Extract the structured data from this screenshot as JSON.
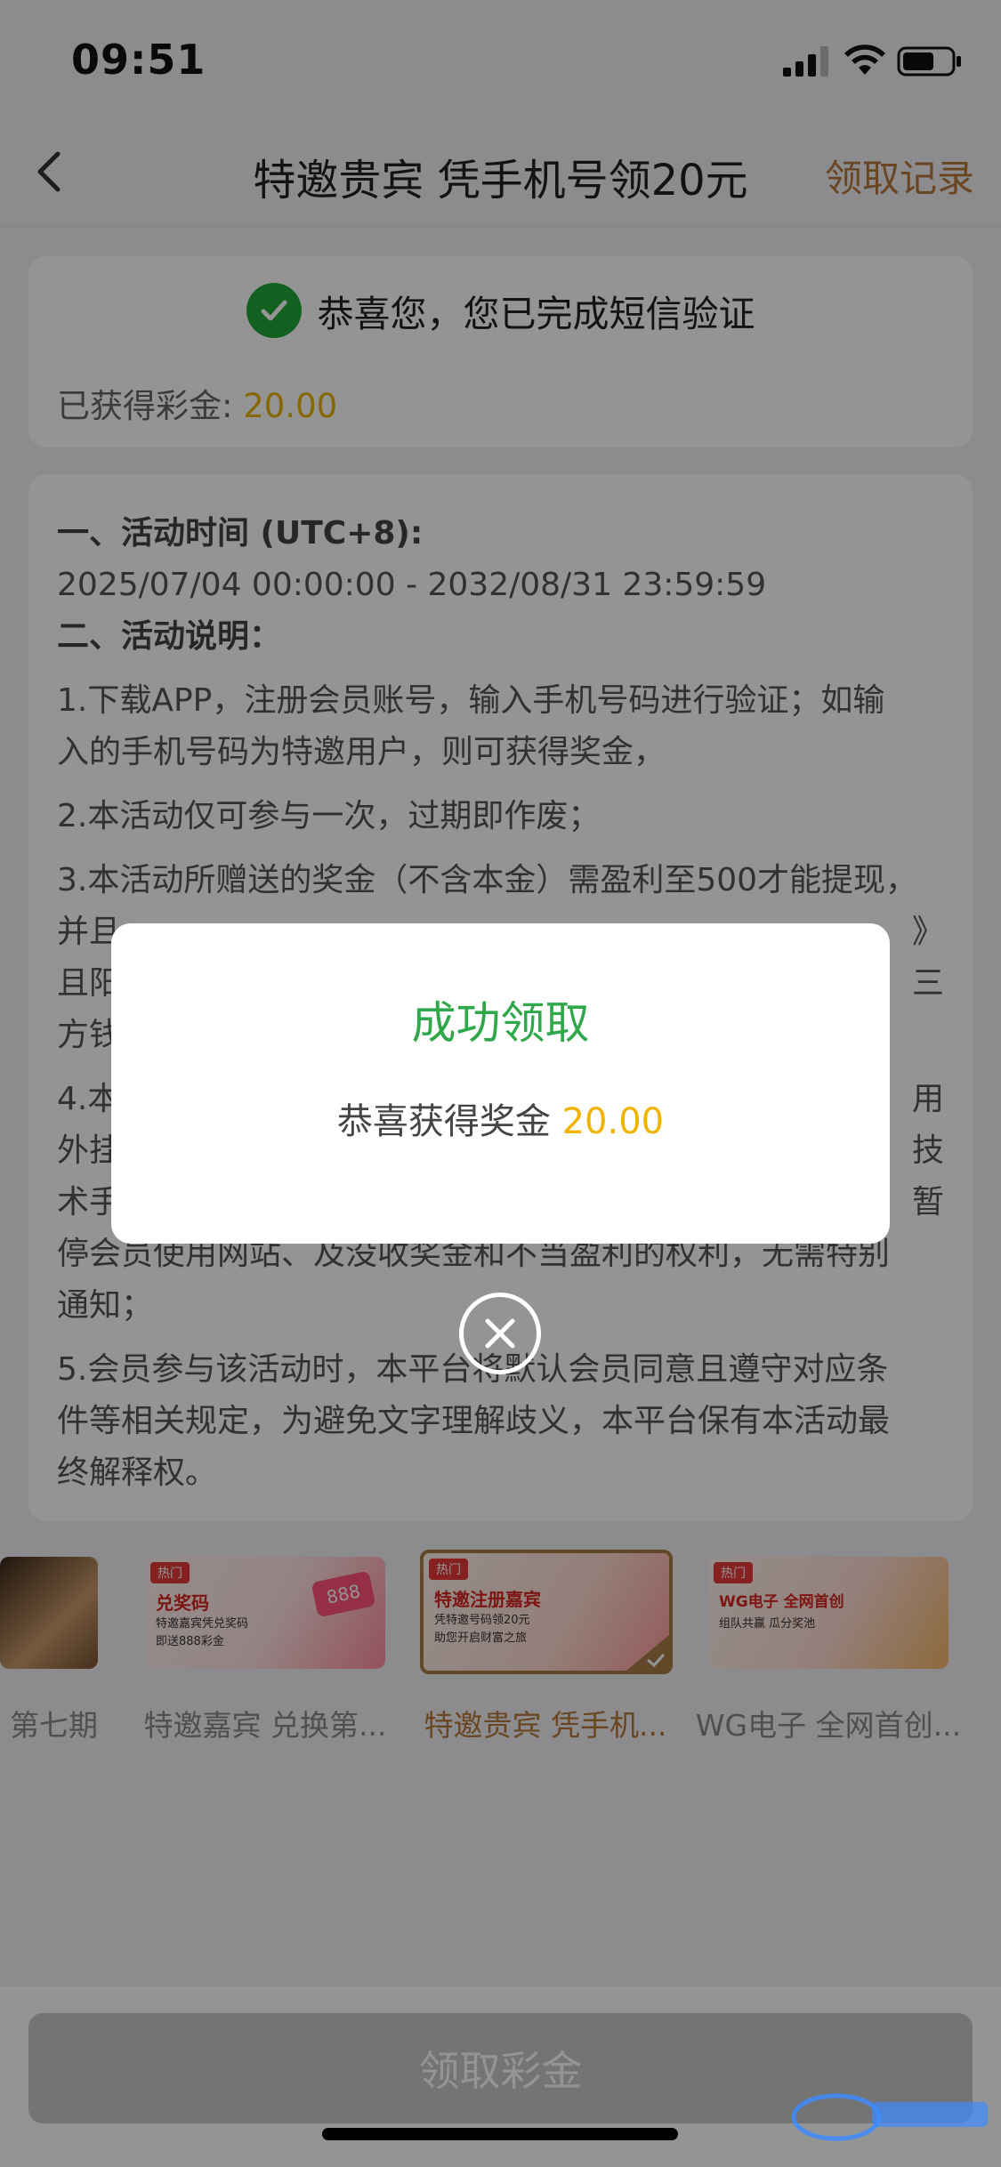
{
  "status": {
    "time": "09:51"
  },
  "nav": {
    "title": "特邀贵宾 凭手机号领20元",
    "record": "领取记录"
  },
  "verify": {
    "message": "恭喜您，您已完成短信验证",
    "earned_label": "已获得彩金: ",
    "earned_value": "20.00"
  },
  "rules": {
    "time_heading": "一、活动时间 (UTC+8):",
    "time_range": "2025/07/04 00:00:00 - 2032/08/31 23:59:59",
    "desc_heading": "二、活动说明：",
    "r1a": "1.下载APP，注册会员账号，输入手机号码进行验证；如输",
    "r1b": "入的手机号码为特邀用户，则可获得奖金，",
    "r2": "2.本活动仅可参与一次，过期即作废；",
    "r3a": "3.本活动所赠送的奖金（不含本金）需盈利至500才能提现，",
    "r3b": "并且",
    "r3b_end": "》",
    "r3c": "且阳",
    "r3c_end": "三",
    "r3d": "方钱",
    "r4a": "4.本",
    "r4a_end": "用",
    "r4b": "外挂",
    "r4b_end": "技",
    "r4c": "术手",
    "r4c_end": "暂",
    "r4d": "停会员使用网站、及没收奖金和不当盈利的权利，无需特别",
    "r4e": "通知；",
    "r5a": "5.会员参与该活动时，本平台将默认会员同意且遵守对应条",
    "r5b": "件等相关规定，为避免文字理解歧义，本平台保有本活动最",
    "r5c": "终解释权。"
  },
  "promos": [
    {
      "caption": "第七期"
    },
    {
      "caption": "特邀嘉宾 兑换第...",
      "hot": "热门",
      "title": "兑奖码",
      "sub": "特邀嘉宾凭兑奖码",
      "sub2": "即送888彩金",
      "badge": "888"
    },
    {
      "caption": "特邀贵宾 凭手机...",
      "hot": "热门",
      "title": "特邀注册嘉宾",
      "sub": "凭特邀号码领20元",
      "sub2": "助您开启财富之旅"
    },
    {
      "caption": "WG电子 全网首创...",
      "hot": "热门",
      "title": "WG电子 全网首创",
      "sub": "组队共赢 瓜分奖池"
    }
  ],
  "bottom": {
    "claim_label": "领取彩金"
  },
  "modal": {
    "title": "成功领取",
    "message": "恭喜获得奖金 ",
    "amount": "20.00"
  },
  "colors": {
    "accent_gold": "#b5793a",
    "success_green": "#2ea84a",
    "amount_yellow": "#f0b400"
  },
  "icons": [
    "back-arrow-icon",
    "check-circle-icon",
    "close-circle-icon",
    "signal-icon",
    "wifi-icon",
    "battery-icon"
  ]
}
